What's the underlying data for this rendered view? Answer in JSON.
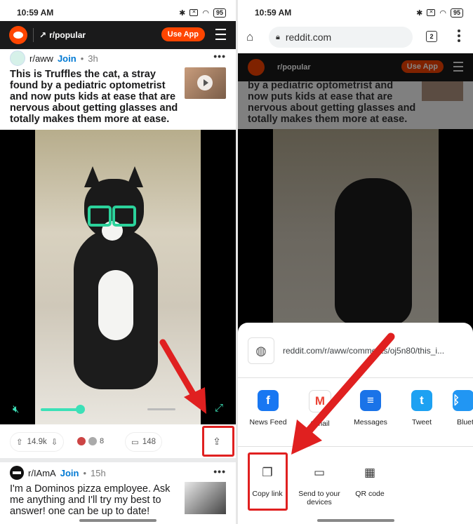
{
  "left": {
    "status": {
      "time": "10:59 AM",
      "battery": "95"
    },
    "header": {
      "subreddit": "r/popular",
      "use_app": "Use App"
    },
    "post1": {
      "subreddit": "r/aww",
      "join": "Join",
      "age": "3h",
      "more": "•••",
      "title": "This is Truffles the cat, a stray found by a pediatric optometrist and now puts kids at ease that are nervous about getting glasses and totally makes them more at ease.",
      "upvotes": "14.9k",
      "awards": "8",
      "comments": "148"
    },
    "post2": {
      "subreddit": "r/IAmA",
      "join": "Join",
      "age": "15h",
      "more": "•••",
      "title": "I'm a Dominos pizza employee. Ask me anything and I'll try my best to answer! one can be up to date!"
    }
  },
  "right": {
    "status": {
      "time": "10:59 AM",
      "battery": "95"
    },
    "browser": {
      "url": "reddit.com",
      "tab_count": "2"
    },
    "underlay": {
      "subreddit": "r/popular",
      "use_app": "Use App",
      "title": "by a pediatric optometrist and now puts kids at ease that are nervous about getting glasses and totally makes them more at ease."
    },
    "share_sheet": {
      "url": "reddit.com/r/aww/comments/oj5n80/this_i...",
      "apps": [
        {
          "label": "News Feed",
          "icon": "facebook-icon",
          "color": "#1877f2"
        },
        {
          "label": "Gmail",
          "icon": "gmail-icon",
          "color": "#ea4335"
        },
        {
          "label": "Messages",
          "icon": "messages-icon",
          "color": "#1a73e8"
        },
        {
          "label": "Tweet",
          "icon": "twitter-icon",
          "color": "#1da1f2"
        },
        {
          "label": "Blueto",
          "icon": "bluetooth-icon",
          "color": "#2196f3"
        }
      ],
      "tools": [
        {
          "label": "Copy link",
          "icon": "copy-icon"
        },
        {
          "label": "Send to your devices",
          "icon": "devices-icon"
        },
        {
          "label": "QR code",
          "icon": "qr-code-icon"
        }
      ]
    }
  },
  "colors": {
    "reddit_orange": "#ff4500",
    "highlight_red": "#e02020",
    "accent_teal": "#3ce0b7"
  }
}
